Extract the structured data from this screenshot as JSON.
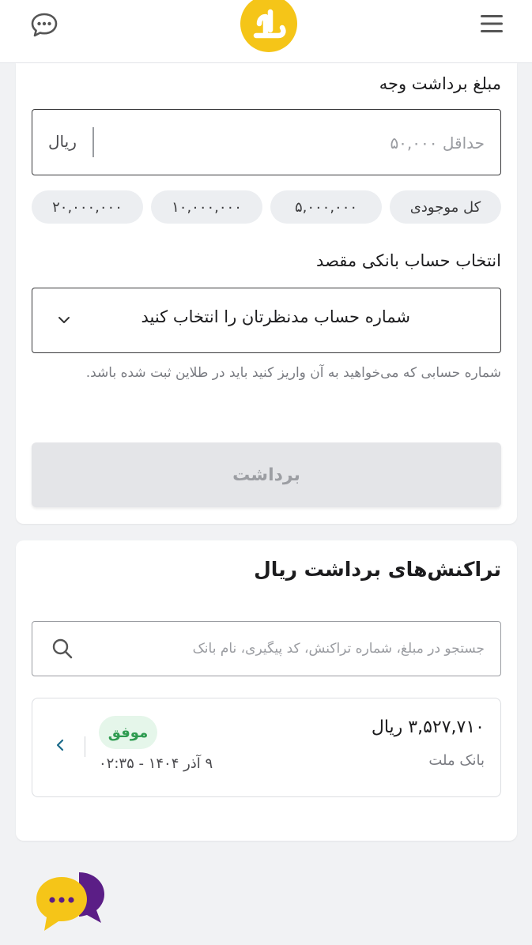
{
  "header": {
    "chat_icon": "chat-bubble-icon",
    "logo_icon": "tala-logo",
    "menu_icon": "hamburger-menu-icon"
  },
  "withdraw": {
    "amount_label": "مبلغ برداشت وجه",
    "amount_placeholder": "حداقل ۵۰,۰۰۰",
    "amount_value": "",
    "unit": "ریال",
    "chips": [
      "کل موجودی",
      "۵,۰۰۰,۰۰۰",
      "۱۰,۰۰۰,۰۰۰",
      "۲۰,۰۰۰,۰۰۰"
    ],
    "account_label": "انتخاب حساب بانکی مقصد",
    "account_select_text": "شماره حساب مدنظرتان را انتخاب کنید",
    "hint": "شماره حسابی که می‌خواهید به آن واریز کنید باید در طلاین ثبت شده باشد.",
    "submit_label": "برداشت"
  },
  "transactions": {
    "title": "تراکنش‌های برداشت ریال",
    "search_placeholder": "جستجو در مبلغ، شماره تراکنش، کد پیگیری، نام بانک",
    "items": [
      {
        "amount": "۳,۵۲۷,۷۱۰ ریال",
        "bank": "بانک ملت",
        "status": "موفق",
        "date": "۹ آذر ۱۴۰۴ - ۰۲:۳۵"
      }
    ]
  },
  "support": {
    "icon": "support-chat-icon"
  },
  "colors": {
    "brand_yellow": "#F5C518",
    "success_green": "#2E9B50",
    "success_bg": "#E5F6EA",
    "support_purple": "#5B1E86"
  }
}
